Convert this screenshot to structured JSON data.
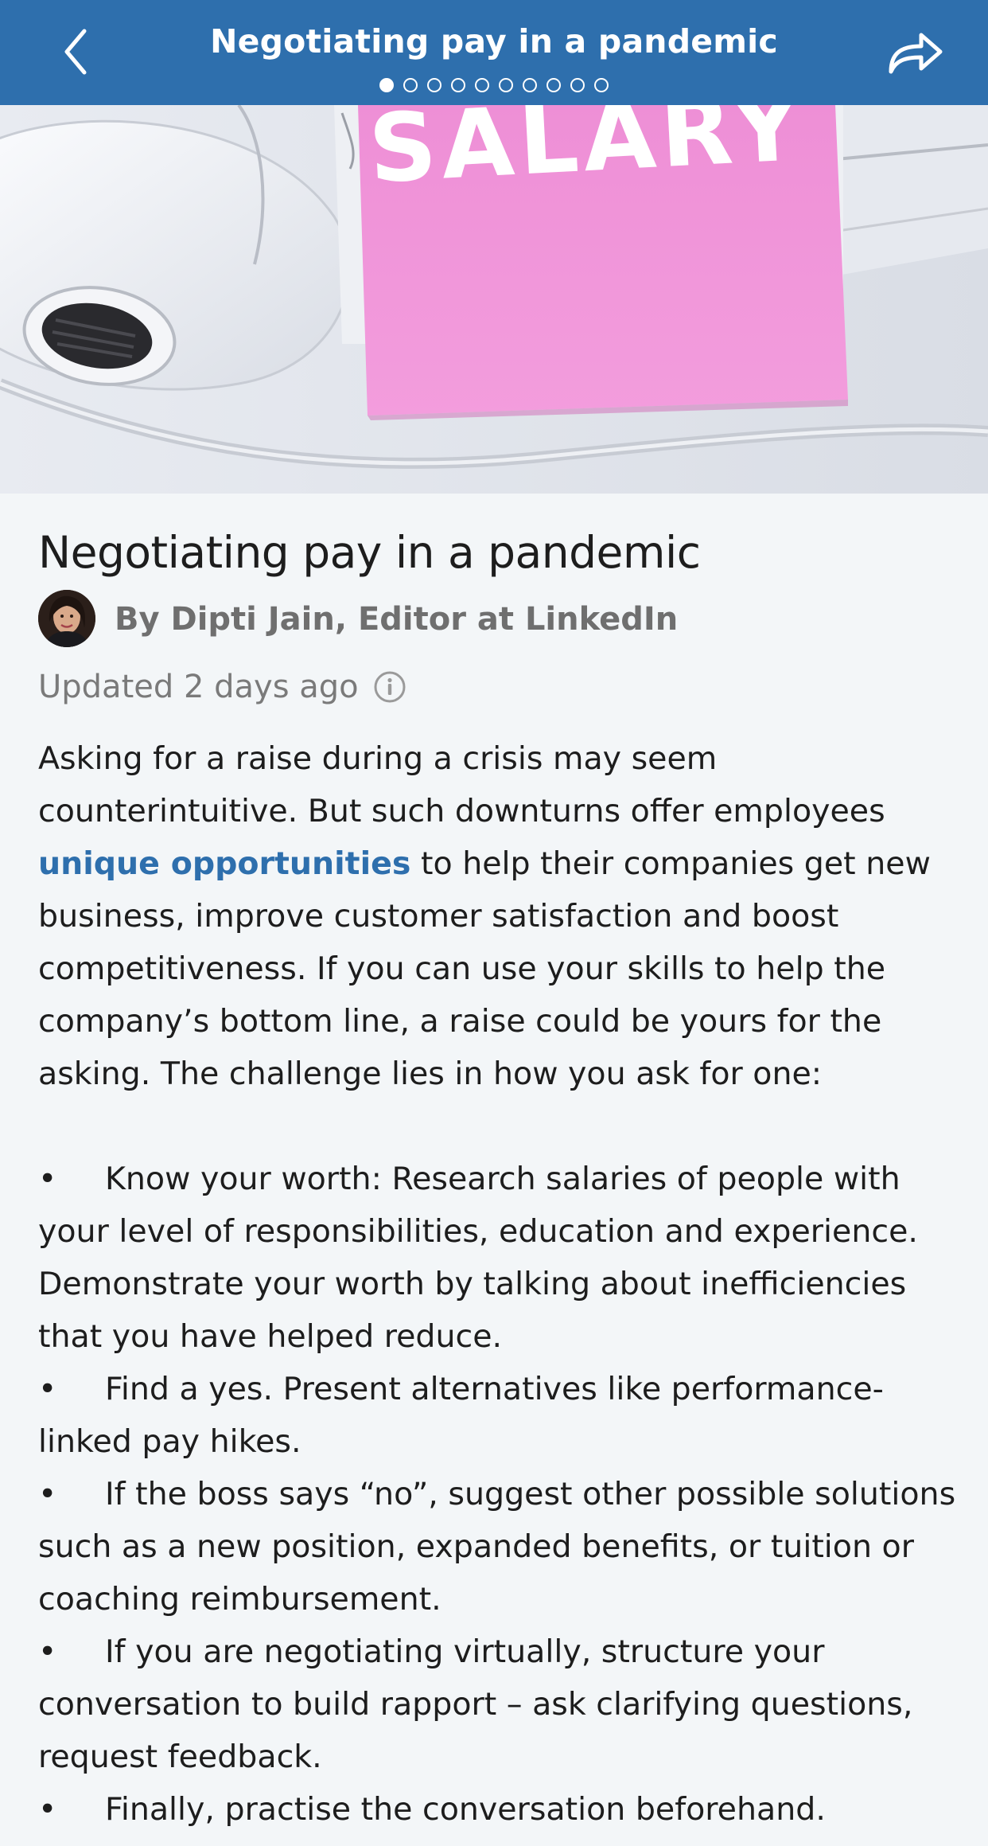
{
  "header": {
    "title": "Negotiating pay in a pandemic",
    "page_count": 10,
    "active_page": 1
  },
  "colors": {
    "header_bg": "#2e6fad",
    "page_bg": "#f3f6f8",
    "link": "#2e6fad",
    "note": "#ec8fd5"
  },
  "hero": {
    "note_text": "SALARY"
  },
  "article": {
    "title": "Negotiating pay in a pandemic",
    "byline": "By Dipti Jain, Editor at LinkedIn",
    "updated": "Updated 2 days ago",
    "intro_lines": {
      "l1": "Asking for a raise during a crisis may seem",
      "l2": "counterintuitive. But such downturns offer employees",
      "l3_link": "unique opportunities",
      "l3_rest": " to help their companies get new",
      "l4": "business, improve customer satisfaction and boost",
      "l5": "competitiveness. If you can use your skills to help the",
      "l6": "company’s bottom line, a raise could be yours for the",
      "l7": "asking. The challenge lies in how you ask for one:"
    },
    "bullet_symbol": "•",
    "bullets": [
      {
        "first": "Know your worth: Research salaries of people with",
        "rest": [
          "your level of responsibilities, education and experience.",
          "Demonstrate your worth by talking about inefficiencies",
          "that you have helped reduce."
        ]
      },
      {
        "first": "Find a yes. Present alternatives like performance-",
        "rest": [
          "linked pay hikes."
        ]
      },
      {
        "first": "If the boss says “no”, suggest other possible solutions",
        "rest": [
          "such as a new position, expanded benefits, or tuition or",
          "coaching reimbursement."
        ]
      },
      {
        "first": "If you are negotiating virtually, structure your",
        "rest": [
          "conversation to build rapport – ask clarifying questions,",
          "request feedback."
        ]
      },
      {
        "first": "Finally, practise the conversation beforehand.",
        "rest": []
      }
    ]
  },
  "icons": {
    "back": "chevron-left-icon",
    "share": "share-arrow-icon",
    "info": "info-icon"
  }
}
